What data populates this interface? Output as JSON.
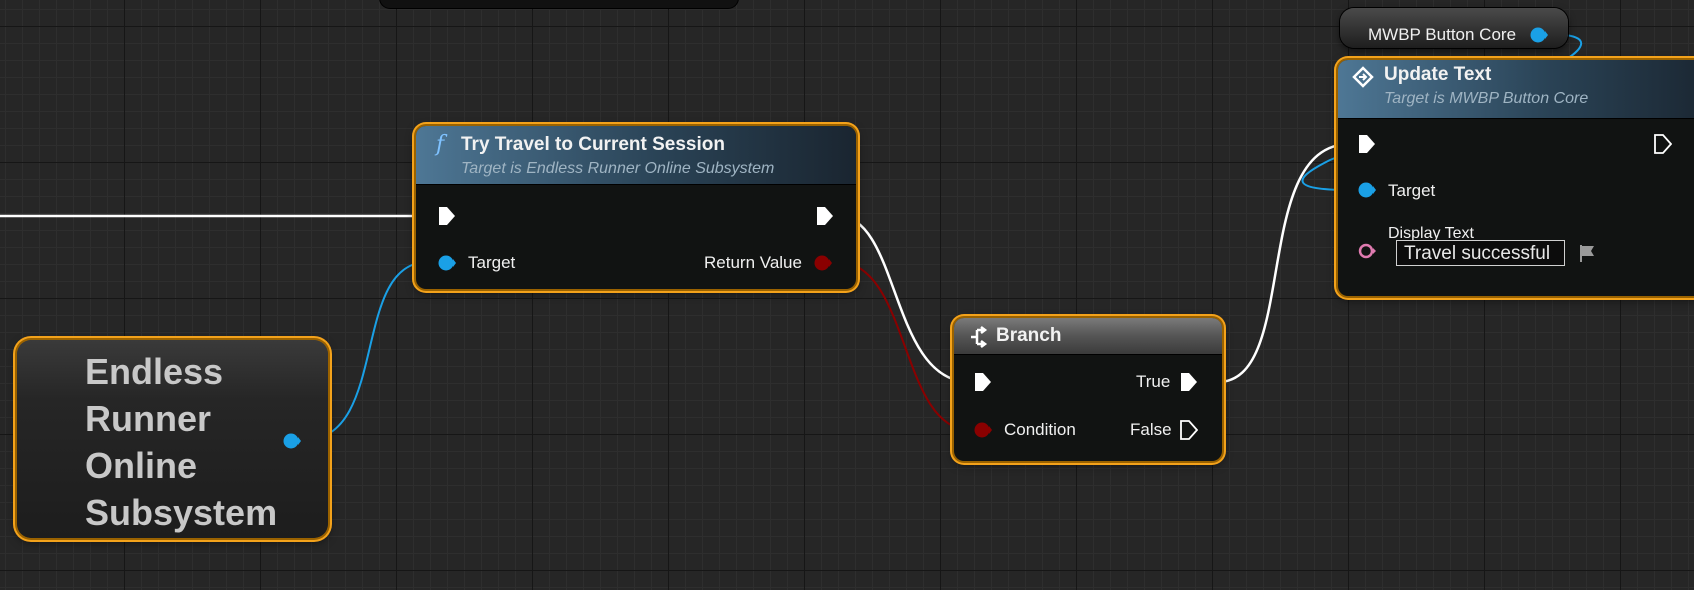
{
  "nodes": {
    "try_travel": {
      "title": "Try Travel to Current Session",
      "subtitle": "Target is Endless Runner Online Subsystem",
      "target_label": "Target",
      "return_label": "Return Value"
    },
    "context": {
      "label": "Endless Runner Online Subsystem"
    },
    "branch": {
      "title": "Branch",
      "true_label": "True",
      "condition_label": "Condition",
      "false_label": "False"
    },
    "button_core_var": {
      "label": "MWBP Button Core"
    },
    "update_text": {
      "title": "Update Text",
      "subtitle": "Target is MWBP Button Core",
      "target_label": "Target",
      "display_text_label": "Display Text",
      "display_text_value": "Travel successful"
    }
  },
  "colors": {
    "exec_wire": "#ffffff",
    "object_wire": "#1aa0e6",
    "bool_wire": "#8a0000",
    "selection": "#f3a21b",
    "text_pin": "#e07bb0"
  },
  "icons": [
    "function-icon",
    "branch-icon",
    "event-icon",
    "localize-flag-icon"
  ]
}
